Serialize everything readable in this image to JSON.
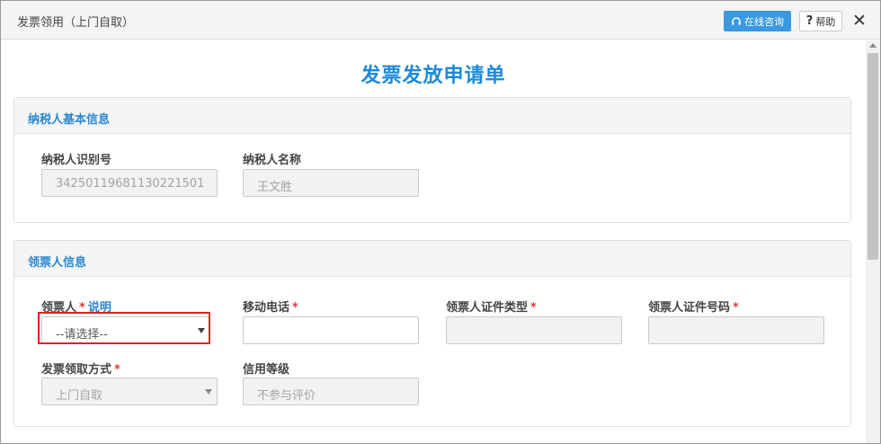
{
  "window": {
    "title": "发票领用（上门自取）",
    "consult_label": "在线咨询",
    "help_label": "帮助",
    "help_glyph": "?",
    "close_glyph": "✕"
  },
  "form": {
    "title": "发票发放申请单"
  },
  "taxpayer": {
    "heading": "纳税人基本信息",
    "id_label": "纳税人识别号",
    "id_value": "34250119681130221501",
    "name_label": "纳税人名称",
    "name_value": "王文胜"
  },
  "recipient": {
    "heading": "领票人信息",
    "person_label": "领票人",
    "person_required": "*",
    "person_desc_link": "说明",
    "person_select_value": "--请选择--",
    "mobile_label": "移动电话",
    "mobile_required": "*",
    "mobile_value": "",
    "cert_type_label": "领票人证件类型",
    "cert_type_required": "*",
    "cert_type_value": "",
    "cert_no_label": "领票人证件号码",
    "cert_no_required": "*",
    "cert_no_value": "",
    "method_label": "发票领取方式",
    "method_required": "*",
    "method_value": "上门自取",
    "credit_label": "信用等级",
    "credit_value": "不参与评价"
  },
  "colors": {
    "accent": "#1b8ad8",
    "section_heading": "#2a88cf",
    "required": "#e03a3a",
    "highlight": "#e02020",
    "consult_button": "#3a99e0"
  },
  "icons": {
    "consult": "headset-icon",
    "close": "close-icon"
  }
}
